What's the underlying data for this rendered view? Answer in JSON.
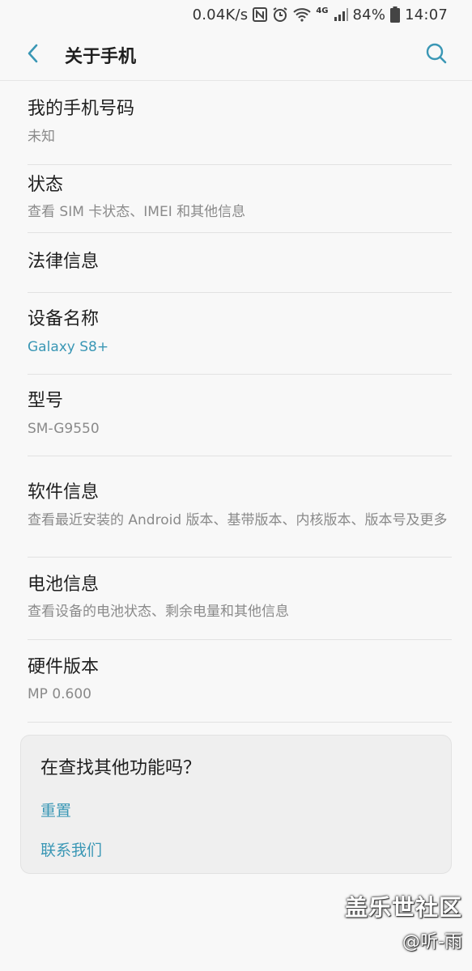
{
  "status_bar": {
    "speed": "0.04K/s",
    "network_type": "4G",
    "battery": "84%",
    "time": "14:07",
    "icons": [
      "nfc-icon",
      "alarm-icon",
      "wifi-icon",
      "signal-icon",
      "battery-icon"
    ]
  },
  "header": {
    "title": "关于手机",
    "icons": [
      "back-arrow-icon",
      "search-icon"
    ]
  },
  "list": {
    "phone_number": {
      "label": "我的手机号码",
      "value": "未知"
    },
    "status": {
      "label": "状态",
      "value": "查看 SIM 卡状态、IMEI 和其他信息"
    },
    "legal": {
      "label": "法律信息"
    },
    "device_name": {
      "label": "设备名称",
      "value": "Galaxy S8+"
    },
    "model": {
      "label": "型号",
      "value": "SM-G9550"
    },
    "software": {
      "label": "软件信息",
      "value": "查看最近安装的 Android 版本、基带版本、内核版本、版本号及更多"
    },
    "battery": {
      "label": "电池信息",
      "value": "查看设备的电池状态、剩余电量和其他信息"
    },
    "hardware": {
      "label": "硬件版本",
      "value": "MP 0.600"
    }
  },
  "suggestion_card": {
    "title": "在查找其他功能吗？",
    "link_reset": "重置",
    "link_contact": "联系我们"
  },
  "watermark": {
    "site": "盖乐世社区",
    "author": "@听-雨"
  },
  "colors": {
    "accent": "#3a97b5",
    "background": "#f8f8f8",
    "card_background": "#efefef"
  }
}
